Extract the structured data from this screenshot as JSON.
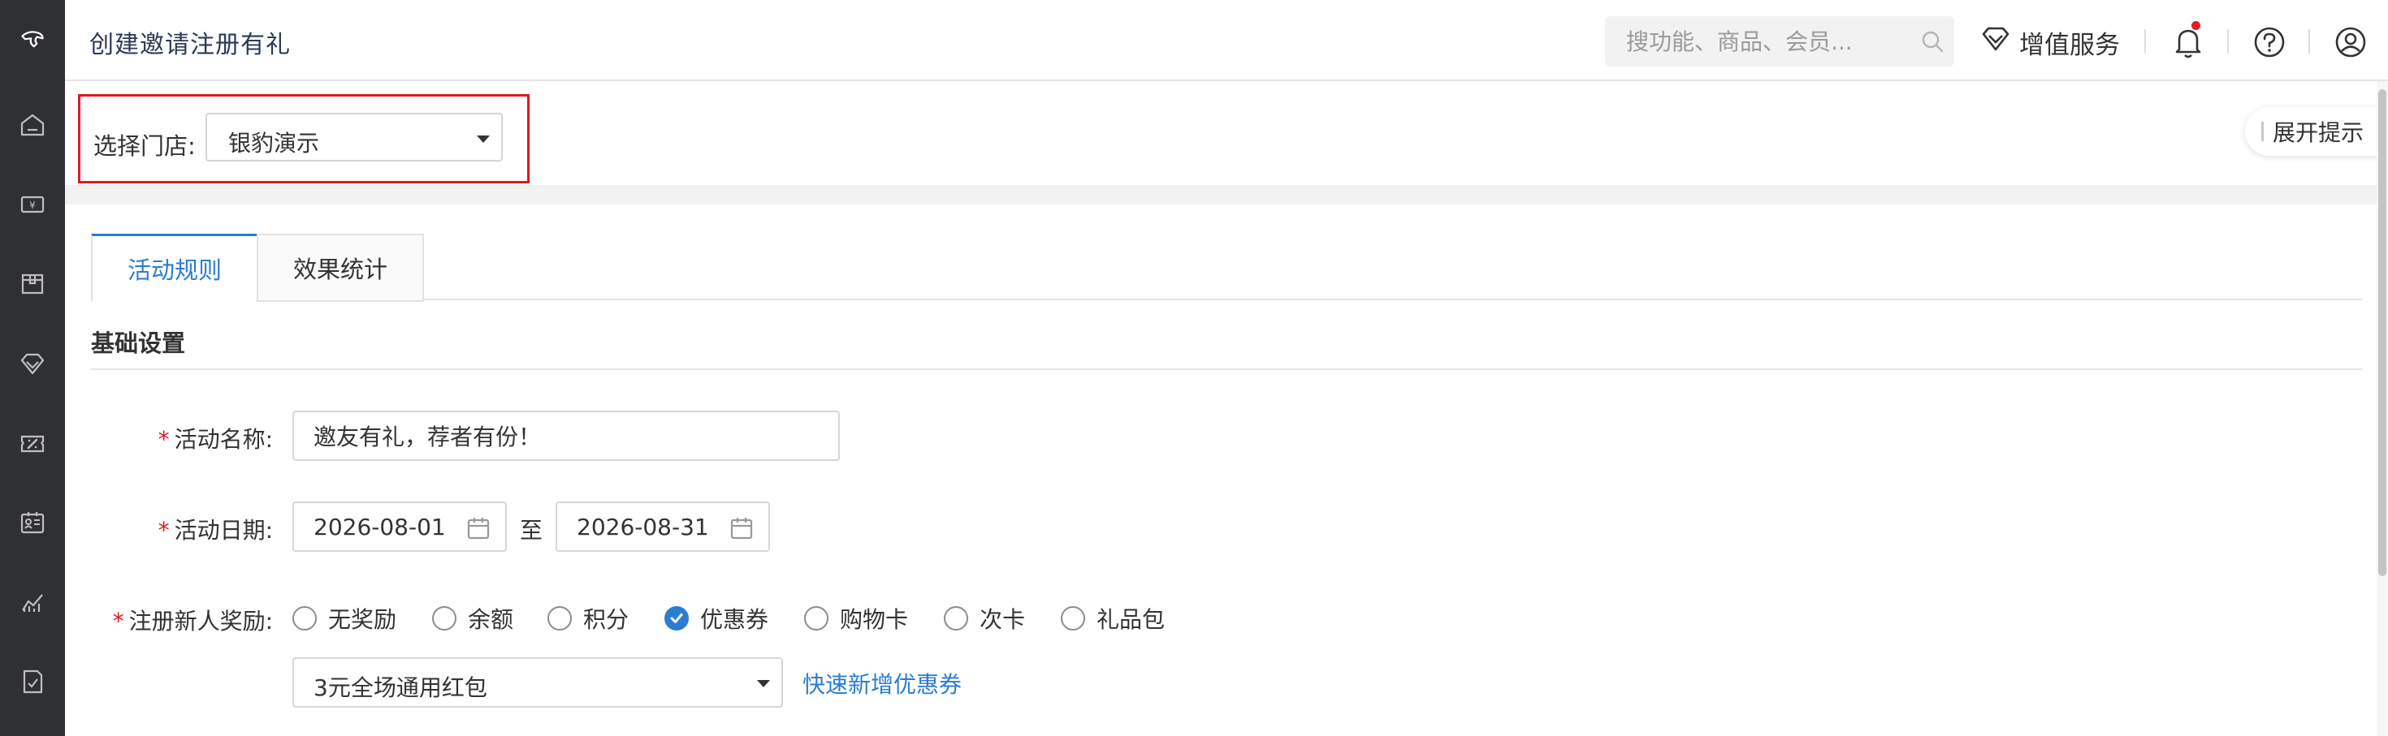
{
  "header": {
    "title": "创建邀请注册有礼",
    "search_placeholder": "搜功能、商品、会员...",
    "value_service": "增值服务",
    "notification_badge_color": "#e02020"
  },
  "sidebar": {
    "items": [
      {
        "icon": "logo-icon"
      },
      {
        "icon": "home-icon"
      },
      {
        "icon": "cashier-icon"
      },
      {
        "icon": "box-icon"
      },
      {
        "icon": "diamond-icon"
      },
      {
        "icon": "coupon-icon"
      },
      {
        "icon": "member-card-icon"
      },
      {
        "icon": "chart-icon"
      },
      {
        "icon": "checklist-icon"
      }
    ]
  },
  "store": {
    "label": "选择门店:",
    "selected": "银豹演示"
  },
  "tips": {
    "label": "展开提示"
  },
  "tabs": [
    {
      "label": "活动规则",
      "active": true
    },
    {
      "label": "效果统计",
      "active": false
    }
  ],
  "section": {
    "title": "基础设置"
  },
  "form": {
    "name_label": "活动名称:",
    "name_value": "邀友有礼，荐者有份！",
    "date_label": "活动日期:",
    "start_date": "2026-08-01",
    "to_label": "至",
    "end_date": "2026-08-31",
    "reward_label": "注册新人奖励:",
    "reward_options": [
      {
        "label": "无奖励",
        "checked": false
      },
      {
        "label": "余额",
        "checked": false
      },
      {
        "label": "积分",
        "checked": false
      },
      {
        "label": "优惠券",
        "checked": true
      },
      {
        "label": "购物卡",
        "checked": false
      },
      {
        "label": "次卡",
        "checked": false
      },
      {
        "label": "礼品包",
        "checked": false
      }
    ],
    "coupon_selected": "3元全场通用红包",
    "quick_add_coupon": "快速新增优惠券"
  },
  "colors": {
    "accent": "#2b7cd3",
    "highlight_border": "#e0191f",
    "sidebar_bg": "#2f3033"
  }
}
